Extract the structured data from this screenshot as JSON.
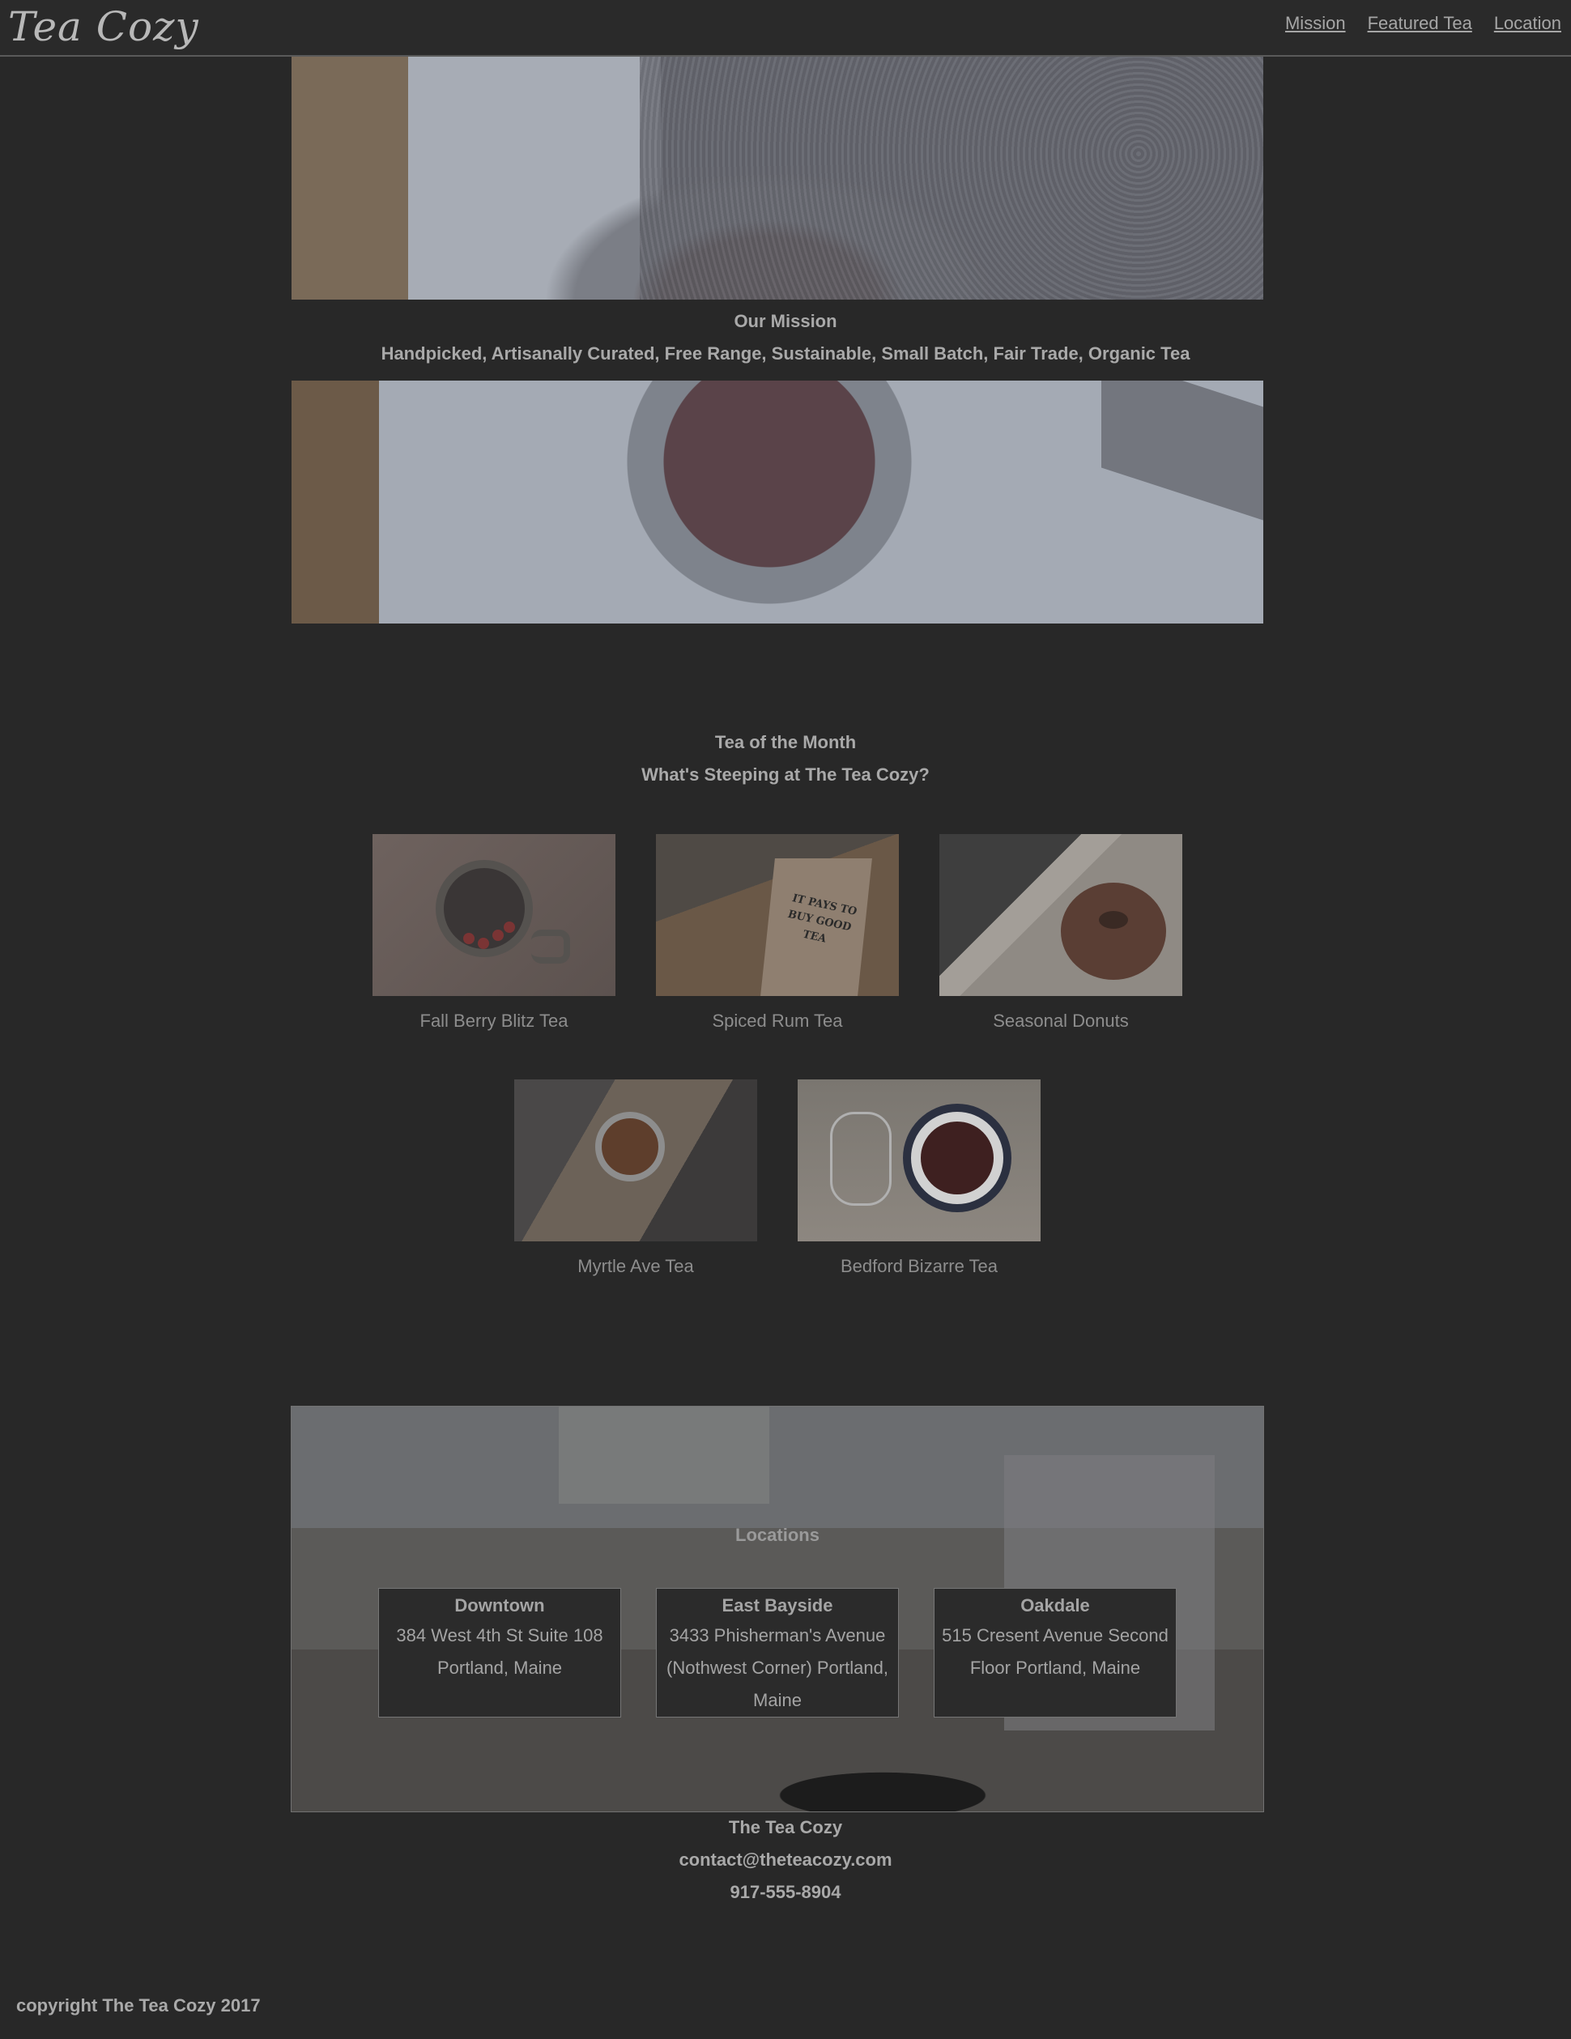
{
  "header": {
    "logo": "Tea Cozy",
    "nav": [
      "Mission",
      "Featured Tea",
      "Location"
    ]
  },
  "mission": {
    "title": "Our Mission",
    "subtitle": "Handpicked, Artisanally Curated, Free Range, Sustainable, Small Batch, Fair Trade, Organic Tea"
  },
  "featured": {
    "title": "Tea of the Month",
    "subtitle": "What's Steeping at The Tea Cozy?",
    "items": [
      {
        "label": "Fall Berry Blitz Tea"
      },
      {
        "label": "Spiced Rum Tea",
        "box_text": "IT PAYS TO BUY GOOD TEA"
      },
      {
        "label": "Seasonal Donuts"
      },
      {
        "label": "Myrtle Ave Tea"
      },
      {
        "label": "Bedford Bizarre Tea"
      }
    ]
  },
  "locations": {
    "title": "Locations",
    "items": [
      {
        "name": "Downtown",
        "address": "384 West 4th St Suite 108 Portland, Maine"
      },
      {
        "name": "East Bayside",
        "address": "3433 Phisherman's Avenue (Nothwest Corner) Portland, Maine"
      },
      {
        "name": "Oakdale",
        "address": "515 Cresent Avenue Second Floor Portland, Maine"
      }
    ]
  },
  "footer": {
    "name": "The Tea Cozy",
    "email": "contact@theteacozy.com",
    "phone": "917-555-8904",
    "copyright": "copyright The Tea Cozy 2017"
  },
  "colors": {
    "background": "#282828",
    "text": "#a9a9a9"
  }
}
